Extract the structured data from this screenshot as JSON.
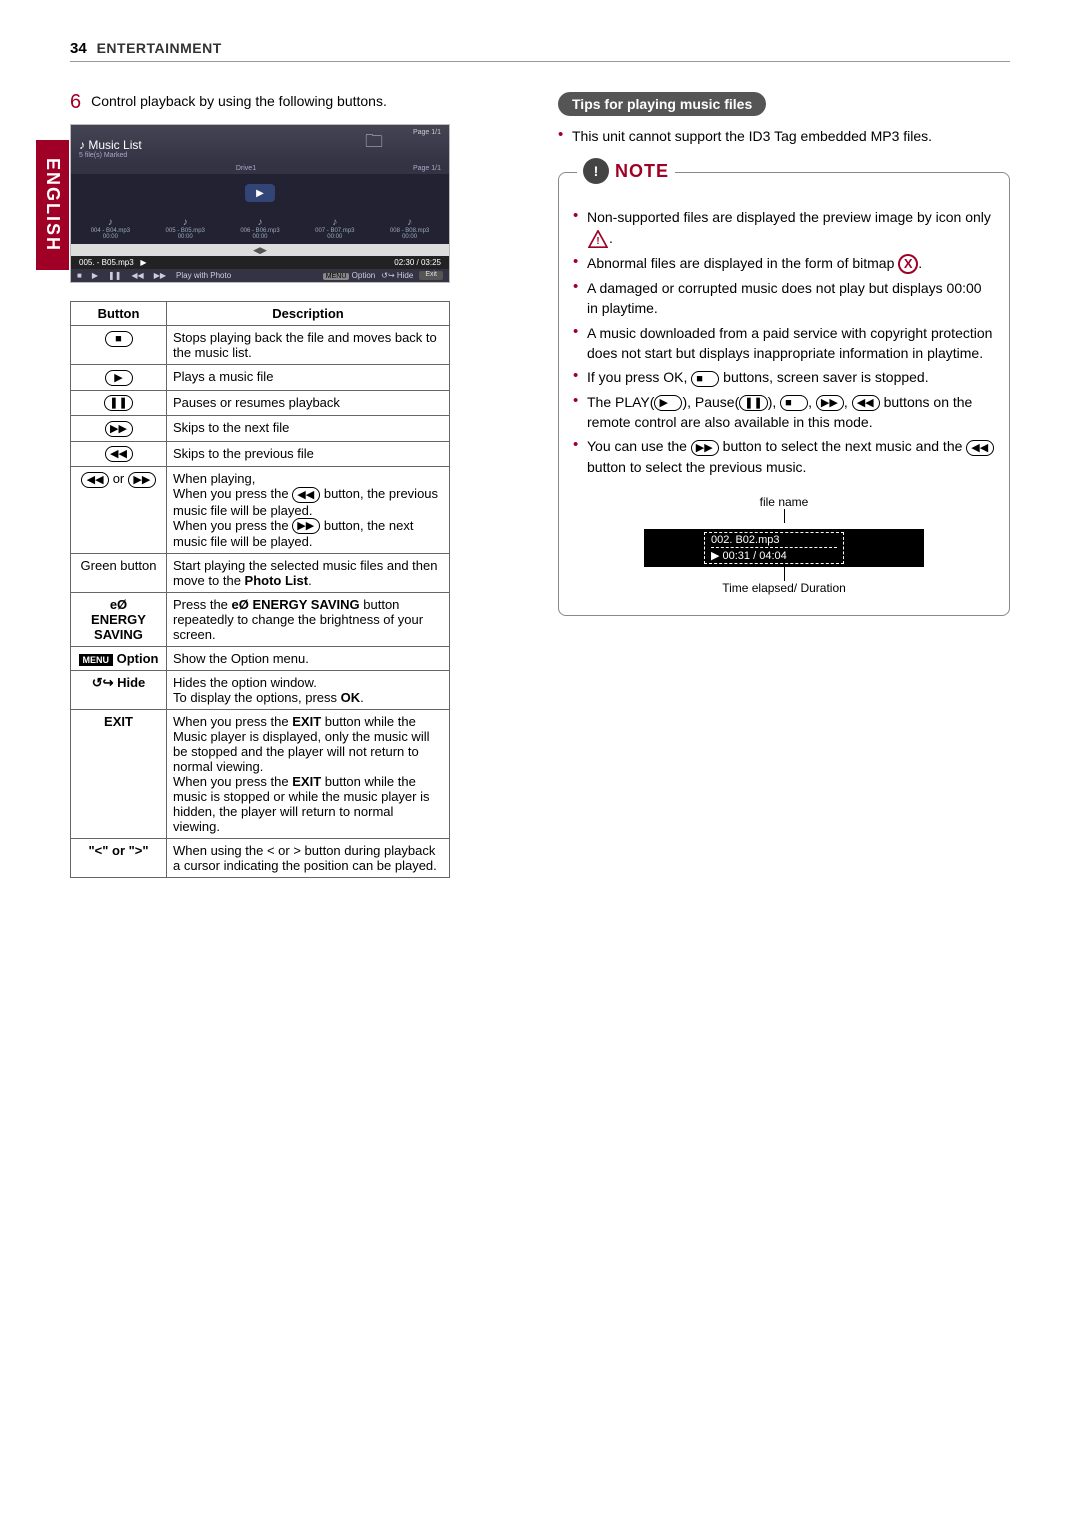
{
  "header": {
    "page_number": "34",
    "section": "ENTERTAINMENT"
  },
  "language_tab": "ENGLISH",
  "left": {
    "step_number": "6",
    "step_text": "Control playback by using the following buttons.",
    "screenshot": {
      "title": "Music List",
      "subtitle": "5 file(s) Marked",
      "page_top": "Page 1/1",
      "drive": "Drive1",
      "page_right": "Page 1/1",
      "items": [
        {
          "name": "004 - B04.mp3",
          "time": "00:00"
        },
        {
          "name": "005 - B05.mp3",
          "time": "00:00"
        },
        {
          "name": "006 - B06.mp3",
          "time": "00:00"
        },
        {
          "name": "007 - B07.mp3",
          "time": "00:00"
        },
        {
          "name": "008 - B08.mp3",
          "time": "00:00"
        }
      ],
      "now_playing_track": "005. - B05.mp3",
      "now_playing_time": "02:30 / 03:25",
      "ctrl_play_with_photo": "Play with Photo",
      "ctrl_menu": "MENU",
      "ctrl_option": "Option",
      "ctrl_hide": "Hide",
      "ctrl_exit": "Exit"
    },
    "table": {
      "h_button": "Button",
      "h_desc": "Description",
      "rows": [
        {
          "btn": "icon-stop",
          "desc": "Stops playing back the file and moves back to the music list."
        },
        {
          "btn": "icon-play",
          "desc": "Plays a music file"
        },
        {
          "btn": "icon-pause",
          "desc": "Pauses or resumes playback"
        },
        {
          "btn": "icon-next",
          "desc": "Skips to the next file"
        },
        {
          "btn": "icon-prev",
          "desc": "Skips to the previous file"
        }
      ],
      "row_prevnext": {
        "btn_join": " or ",
        "l1": "When playing,",
        "l2a": "When you press the ",
        "l2b": " button, the previous music file will be played.",
        "l3a": "When you press the ",
        "l3b": " button, the next music file will be played."
      },
      "row_green": {
        "btn": "Green button",
        "d1": "Start playing the selected music files and then move to the ",
        "d2": "Photo List",
        "d3": "."
      },
      "row_energy": {
        "btn_icon": "eØ",
        "btn_l1": "ENERGY",
        "btn_l2": "SAVING",
        "d1": "Press the ",
        "d2": "eØ",
        "d3": " ENERGY SAVING",
        "d4": " button repeatedly to change the brightness of your screen."
      },
      "row_option": {
        "btn_badge": "MENU",
        "btn_text": " Option",
        "desc": "Show the Option menu."
      },
      "row_hide": {
        "btn_icon": "↺↪",
        "btn_text": " Hide",
        "d1": "Hides the option window.",
        "d2": "To display the options, press ",
        "d3": "OK",
        "d4": "."
      },
      "row_exit": {
        "btn": "EXIT",
        "d1": "When you press the ",
        "d2": "EXIT",
        "d3": " button while the Music player is displayed, only the music will be stopped and the player will not return to normal viewing.",
        "d4": "When you press the ",
        "d5": "EXIT",
        "d6": " button while the music is stopped or while the music player is hidden, the player will return to normal  viewing."
      },
      "row_arrows": {
        "btn": "\"<\" or \">\"",
        "desc": "When using the < or > button during playback a cursor indicating the position can be played."
      }
    }
  },
  "right": {
    "tips_title": "Tips for playing music files",
    "tip1": "This unit cannot support the ID3 Tag embedded MP3 files.",
    "note_title": "NOTE",
    "notes": {
      "n1a": "Non-supported files are displayed the preview image by icon only ",
      "n1b": ".",
      "n2a": "Abnormal files are displayed in the form of bitmap ",
      "n2b": ".",
      "n3": "A damaged or corrupted music does not play but displays 00:00 in playtime.",
      "n4": "A music downloaded from a paid service with copyright protection does not start but displays inappropriate information in playtime.",
      "n5a": "If you press OK, ",
      "n5b": " buttons, screen saver is stopped.",
      "n6a": "The PLAY(",
      "n6b": "), Pause(",
      "n6c": "), ",
      "n6d": ", ",
      "n6e": ", ",
      "n6f": " buttons on the remote control are also available in this mode.",
      "n7a": "You can use the ",
      "n7b": " button to select the next music and the ",
      "n7c": " button to select the previous music."
    },
    "diagram": {
      "label_top": "file name",
      "file": "002. B02.mp3",
      "time": "▶ 00:31 / 04:04",
      "label_bottom": "Time elapsed/ Duration"
    }
  }
}
